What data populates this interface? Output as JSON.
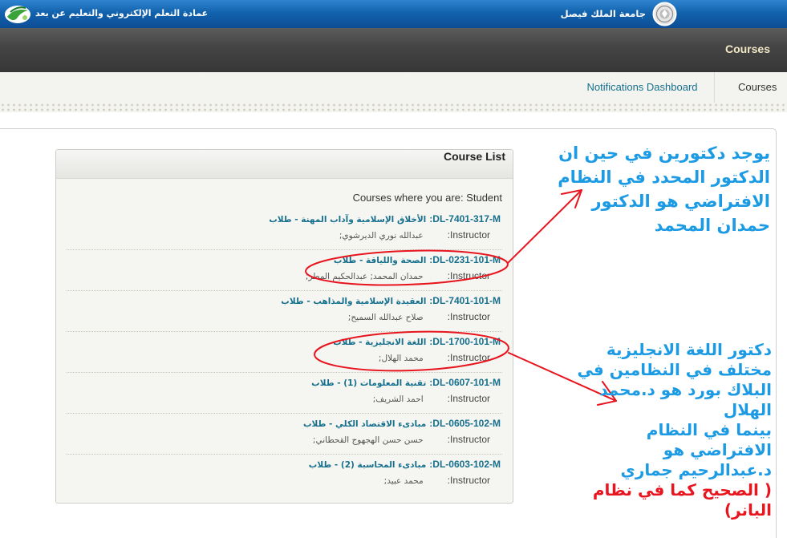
{
  "header": {
    "deanship_title": "عمادة التعلم الإلكتروني والتعليم عن بعد",
    "university_name": "جامعة الملك فيصل",
    "logo_icon": "deanship-logo-icon",
    "seal_icon": "university-seal-icon"
  },
  "nav_bar": {
    "title": "Courses"
  },
  "tabs": [
    {
      "label": "Notifications Dashboard",
      "active": false
    },
    {
      "label": "Courses",
      "active": true
    }
  ],
  "course_list": {
    "title": "Course List",
    "role_line": "Courses where you are: Student",
    "instructor_label": "Instructor:",
    "courses": [
      {
        "code": "DL-7401-317-M:",
        "name": "الأخلاق الإسلامية وآداب المهنة - طلاب",
        "instructors": "عبدالله نوري الديرشوي;",
        "circled": false
      },
      {
        "code": "DL-0231-101-M:",
        "name": "الصحة واللياقة - طلاب",
        "instructors": "حمدان المحمد;  عبدالحكيم المطر;",
        "circled": true
      },
      {
        "code": "DL-7401-101-M:",
        "name": "العقيدة الإسلامية والمذاهب - طلاب",
        "instructors": "صلاح عبدالله السميح;",
        "circled": false
      },
      {
        "code": "DL-1700-101-M:",
        "name": "اللغة الانجليزية - طلاب",
        "instructors": "محمد الهلال;",
        "circled": true
      },
      {
        "code": "DL-0607-101-M:",
        "name": "تقنية المعلومات (1) - طلاب",
        "instructors": "احمد الشريف;",
        "circled": false
      },
      {
        "code": "DL-0605-102-M:",
        "name": "مبادىء الاقتصاد الكلي - طلاب",
        "instructors": "حسن حسن الهجهوج القحطاني;",
        "circled": false
      },
      {
        "code": "DL-0603-102-M:",
        "name": "مبادىء المحاسبة (2) - طلاب",
        "instructors": "محمد عبيد;",
        "circled": false
      }
    ]
  },
  "annotations": {
    "note_1": {
      "lines": [
        "يوجد دكتورين في حين ان",
        "الدكتور المحدد في النظام",
        "الافتراضي هو الدكتور",
        "حمدان المحمد"
      ]
    },
    "note_2": {
      "lines": [
        "دكتور اللغة الانجليزية",
        "مختلف في النظامين في",
        "البلاك بورد هو د.محمد",
        "الهلال",
        "بينما في النظام",
        "الافتراضي هو",
        "د.عبدالرحيم جماري"
      ],
      "emphasis_lines": [
        "( الصحيح كما في نظام",
        "البانر)"
      ]
    }
  },
  "colors": {
    "link": "#16708d",
    "header_blue": "#1262ad",
    "annotation_text": "#1c9be4",
    "annotation_emphasis": "#e8141e",
    "annotation_mark": "#e8141e"
  }
}
